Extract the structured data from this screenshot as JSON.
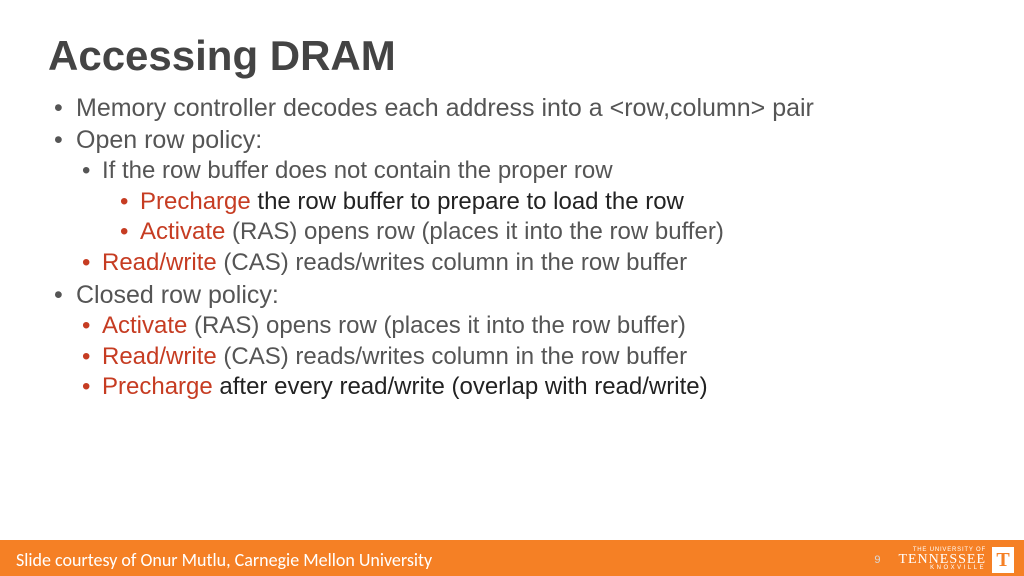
{
  "title": "Accessing DRAM",
  "b1": "Memory controller decodes each address into a <row,column> pair",
  "b2": "Open row policy:",
  "b2a": "If the row buffer does not contain the proper row",
  "b2a1_red": "Precharge",
  "b2a1_rest": " the row buffer to prepare to load the row",
  "b2a2_red": "Activate",
  "b2a2_rest": " (RAS) opens row (places it into the row buffer)",
  "b2b_red": "Read/write",
  "b2b_rest": " (CAS) reads/writes column in the row buffer",
  "b3": "Closed row policy:",
  "b3a_red": "Activate",
  "b3a_rest": " (RAS) opens row (places it into the row buffer)",
  "b3b_red": "Read/write",
  "b3b_rest": " (CAS) reads/writes column in the row buffer",
  "b3c_red": "Precharge",
  "b3c_rest": " after every read/write (overlap with read/write)",
  "footer_credit": "Slide courtesy of Onur Mutlu, Carnegie Mellon University",
  "page_num": "9",
  "logo": {
    "top": "THE UNIVERSITY OF",
    "mid": "TENNESSEE",
    "bot": "KNOXVILLE",
    "t": "T"
  }
}
